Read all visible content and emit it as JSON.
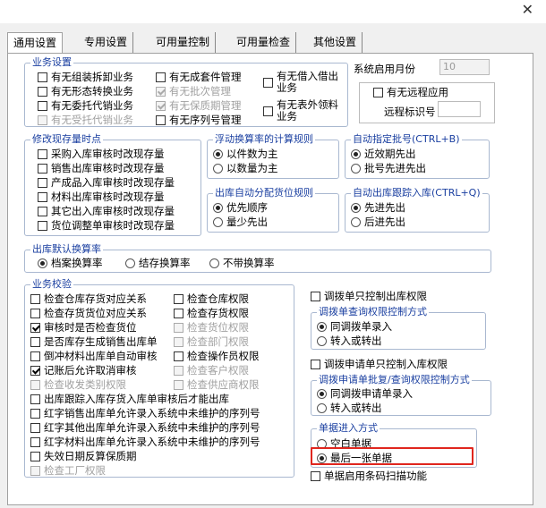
{
  "window": {
    "close_glyph": "✕"
  },
  "tabs": [
    {
      "label": "通用设置",
      "active": true
    },
    {
      "label": "专用设置"
    },
    {
      "label": "可用量控制"
    },
    {
      "label": "可用量检查"
    },
    {
      "label": "其他设置"
    }
  ],
  "biz_settings": {
    "title": "业务设置",
    "col1": [
      {
        "label": "有无组装拆卸业务",
        "checked": false,
        "disabled": false
      },
      {
        "label": "有无形态转换业务",
        "checked": false,
        "disabled": false
      },
      {
        "label": "有无委托代销业务",
        "checked": false,
        "disabled": false
      },
      {
        "label": "有无受托代销业务",
        "checked": false,
        "disabled": true
      }
    ],
    "col2": [
      {
        "label": "有无成套件管理",
        "checked": false,
        "disabled": false
      },
      {
        "label": "有无批次管理",
        "checked": true,
        "disabled": true
      },
      {
        "label": "有无保质期管理",
        "checked": true,
        "disabled": true
      },
      {
        "label": "有无序列号管理",
        "checked": false,
        "disabled": false
      }
    ],
    "col3": [
      {
        "line1": "有无借入借出",
        "line2": "业务",
        "checked": false
      },
      {
        "line1": "有无表外领料",
        "line2": "业务",
        "checked": false
      }
    ]
  },
  "system_month": {
    "label": "系统启用月份",
    "value": "10"
  },
  "remote": {
    "checkbox_label": "有无远程应用",
    "checked": false,
    "id_label": "远程标识号",
    "id_value": ""
  },
  "modify_stock": {
    "title": "修改现存量时点",
    "items": [
      {
        "label": "采购入库审核时改现存量",
        "checked": false
      },
      {
        "label": "销售出库审核时改现存量",
        "checked": false
      },
      {
        "label": "产成品入库审核时改现存量",
        "checked": false
      },
      {
        "label": "材料出库审核时改现存量",
        "checked": false
      },
      {
        "label": "其它出入库审核时改现存量",
        "checked": false
      },
      {
        "label": "货位调整单审核时改现存量",
        "checked": false
      }
    ]
  },
  "float_calc": {
    "title": "浮动换算率的计算规则",
    "options": [
      {
        "label": "以件数为主",
        "selected": true
      },
      {
        "label": "以数量为主",
        "selected": false
      }
    ]
  },
  "auto_batch": {
    "title": "自动指定批号(CTRL+B)",
    "options": [
      {
        "label": "近效期先出",
        "selected": true
      },
      {
        "label": "批号先进先出",
        "selected": false
      }
    ]
  },
  "auto_location": {
    "title": "出库自动分配货位规则",
    "options": [
      {
        "label": "优先顺序",
        "selected": true
      },
      {
        "label": "量少先出",
        "selected": false
      }
    ]
  },
  "auto_outbound_track": {
    "title": "自动出库跟踪入库(CTRL+Q)",
    "options": [
      {
        "label": "先进先出",
        "selected": true
      },
      {
        "label": "后进先出",
        "selected": false
      }
    ]
  },
  "outbound_rate": {
    "title": "出库默认换算率",
    "options": [
      {
        "label": "档案换算率",
        "selected": true
      },
      {
        "label": "结存换算率",
        "selected": false
      },
      {
        "label": "不带换算率",
        "selected": false
      }
    ]
  },
  "biz_check": {
    "title": "业务校验",
    "left": [
      {
        "label": "检查仓库存货对应关系",
        "checked": false,
        "disabled": false
      },
      {
        "label": "检查存货货位对应关系",
        "checked": false,
        "disabled": false
      },
      {
        "label": "审核时是否检查货位",
        "checked": true,
        "disabled": false
      },
      {
        "label": "是否库存生成销售出库单",
        "checked": false,
        "disabled": false
      },
      {
        "label": "倒冲材料出库单自动审核",
        "checked": false,
        "disabled": false
      },
      {
        "label": "记账后允许取消审核",
        "checked": true,
        "disabled": false
      },
      {
        "label": "检查收发类别权限",
        "checked": false,
        "disabled": true
      }
    ],
    "right": [
      {
        "label": "检查仓库权限",
        "checked": false,
        "disabled": false
      },
      {
        "label": "检查存货权限",
        "checked": false,
        "disabled": false
      },
      {
        "label": "检查货位权限",
        "checked": false,
        "disabled": true
      },
      {
        "label": "检查部门权限",
        "checked": false,
        "disabled": true
      },
      {
        "label": "检查操作员权限",
        "checked": false,
        "disabled": false
      },
      {
        "label": "检查客户权限",
        "checked": false,
        "disabled": true
      },
      {
        "label": "检查供应商权限",
        "checked": false,
        "disabled": true
      }
    ],
    "full": [
      {
        "label": "出库跟踪入库存货入库单审核后才能出库",
        "checked": false,
        "disabled": false
      },
      {
        "label": "红字销售出库单允许录入系统中未维护的序列号",
        "checked": false,
        "disabled": false
      },
      {
        "label": "红字其他出库单允许录入系统中未维护的序列号",
        "checked": false,
        "disabled": false
      },
      {
        "label": "红字材料出库单允许录入系统中未维护的序列号",
        "checked": false,
        "disabled": false
      },
      {
        "label": "失效日期反算保质期",
        "checked": false,
        "disabled": false
      },
      {
        "label": "检查工厂权限",
        "checked": false,
        "disabled": true
      }
    ]
  },
  "transfer": {
    "only_control_label": "调拨单只控制出库权限",
    "only_control_checked": false,
    "query_title": "调拨单查询权限控制方式",
    "query_options": [
      {
        "label": "同调拨单录入",
        "selected": true
      },
      {
        "label": "转入或转出",
        "selected": false
      }
    ],
    "apply_only_label": "调拨申请单只控制入库权限",
    "apply_only_checked": false,
    "apply_title": "调拨申请单批复/查询权限控制方式",
    "apply_options": [
      {
        "label": "同调拨申请单录入",
        "selected": true
      },
      {
        "label": "转入或转出",
        "selected": false
      }
    ]
  },
  "doc_entry": {
    "title": "单据进入方式",
    "options": [
      {
        "label": "空白单据",
        "selected": false
      },
      {
        "label": "最后一张单据",
        "selected": true
      }
    ]
  },
  "barcode": {
    "label": "单据启用条码扫描功能",
    "checked": false
  },
  "colors": {
    "group_title": "#1a3fa0",
    "highlight": "#e0261e",
    "group_border": "#a9b8d0"
  }
}
